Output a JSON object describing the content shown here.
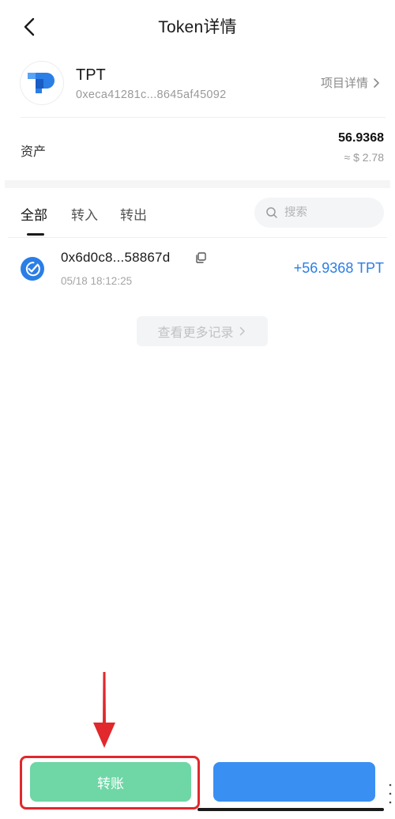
{
  "header": {
    "title": "Token详情",
    "back_icon": "chevron-left-icon"
  },
  "token": {
    "symbol": "TPT",
    "address": "0xeca41281c...8645af45092",
    "project_link_label": "项目详情",
    "logo_icon": "tpt-logo-icon",
    "logo_color": "#2a7ee6"
  },
  "asset": {
    "label": "资产",
    "amount": "56.9368",
    "fiat_value": "≈ $ 2.78"
  },
  "tabs": [
    {
      "label": "全部",
      "active": true
    },
    {
      "label": "转入",
      "active": false
    },
    {
      "label": "转出",
      "active": false
    }
  ],
  "search": {
    "placeholder": "搜索"
  },
  "transactions": [
    {
      "hash": "0x6d0c8...58867d",
      "time": "05/18 18:12:25",
      "amount": "+56.9368 TPT",
      "status_icon": "check-circle-icon"
    }
  ],
  "view_more": {
    "label": "查看更多记录"
  },
  "actions": {
    "transfer_label": "转账",
    "receive_label": ""
  },
  "colors": {
    "accent_blue": "#2a7ee6",
    "transfer_green": "#6fd6a6",
    "receive_blue": "#3a8ff3",
    "annotation_red": "#e0282d"
  }
}
